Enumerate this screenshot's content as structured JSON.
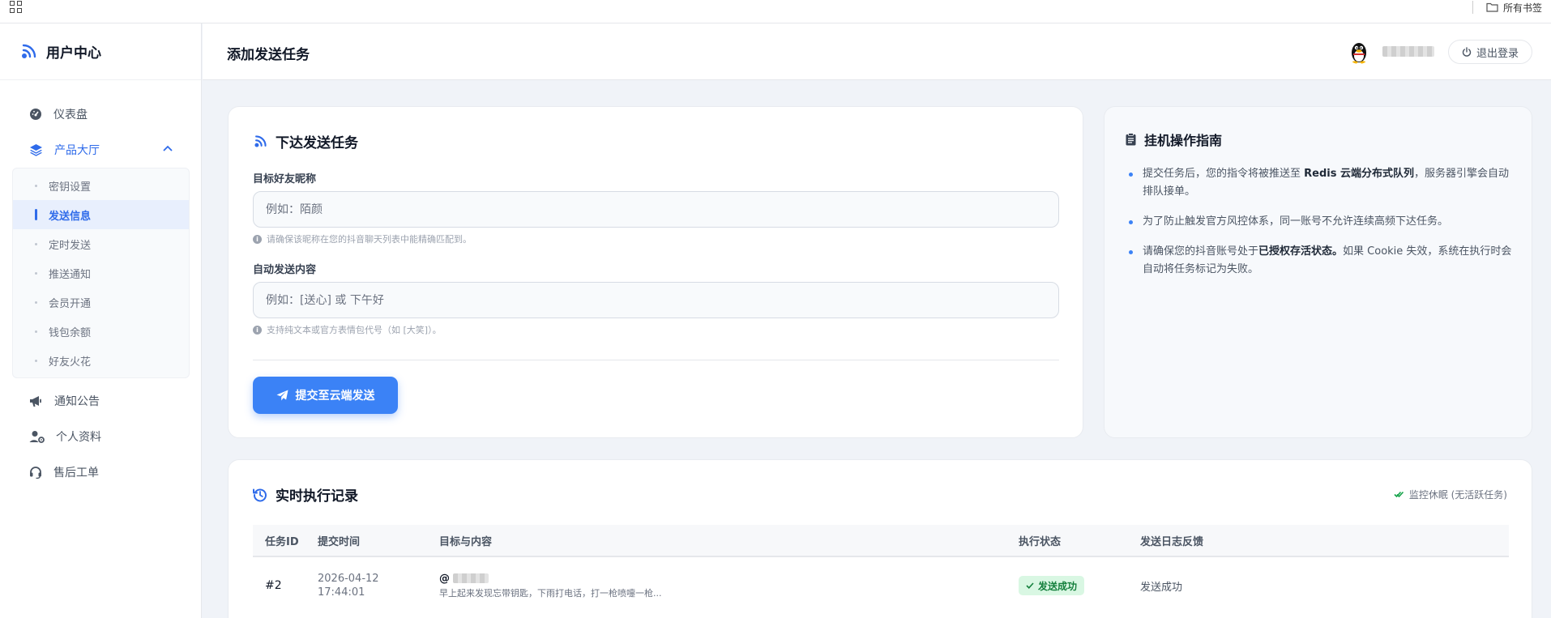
{
  "bookmarks": {
    "all_label": "所有书签"
  },
  "sidebar": {
    "brand": "用户中心",
    "items": [
      {
        "label": "仪表盘"
      },
      {
        "label": "产品大厅"
      },
      {
        "label": "通知公告"
      },
      {
        "label": "个人资料"
      },
      {
        "label": "售后工单"
      }
    ],
    "sub_items": [
      {
        "label": "密钥设置"
      },
      {
        "label": "发送信息"
      },
      {
        "label": "定时发送"
      },
      {
        "label": "推送通知"
      },
      {
        "label": "会员开通"
      },
      {
        "label": "钱包余额"
      },
      {
        "label": "好友火花"
      }
    ]
  },
  "header": {
    "title": "添加发送任务",
    "logout_label": "退出登录"
  },
  "form": {
    "title": "下达发送任务",
    "target_label": "目标好友昵称",
    "target_placeholder": "例如：陌颜",
    "target_hint": "请确保该昵称在您的抖音聊天列表中能精确匹配到。",
    "content_label": "自动发送内容",
    "content_placeholder": "例如：[送心] 或 下午好",
    "content_hint": "支持纯文本或官方表情包代号（如 [大笑]）。",
    "submit_label": "提交至云端发送"
  },
  "guide": {
    "title": "挂机操作指南",
    "items": [
      {
        "pre": "提交任务后，您的指令将被推送至 ",
        "bold": "Redis 云端分布式队列",
        "post": "，服务器引擎会自动排队接单。"
      },
      {
        "pre": "为了防止触发官方风控体系，同一账号不允许连续高频下达任务。",
        "bold": "",
        "post": ""
      },
      {
        "pre": "请确保您的抖音账号处于",
        "bold": "已授权存活状态。",
        "post": "如果 Cookie 失效，系统在执行时会自动将任务标记为失败。"
      }
    ]
  },
  "log": {
    "title": "实时执行记录",
    "monitor": "监控休眠 (无活跃任务)",
    "columns": [
      "任务ID",
      "提交时间",
      "目标与内容",
      "执行状态",
      "发送日志反馈"
    ],
    "rows": [
      {
        "id": "#2",
        "date": "2026-04-12",
        "time": "17:44:01",
        "at": "@",
        "content": "早上起来发现忘带钥匙，下雨打电话，打一枪喷嚏一枪...",
        "status": "发送成功",
        "feedback": "发送成功"
      }
    ]
  },
  "colors": {
    "accent": "#3b82f6",
    "success_bg": "#d9f7e3",
    "success_fg": "#15803d"
  }
}
